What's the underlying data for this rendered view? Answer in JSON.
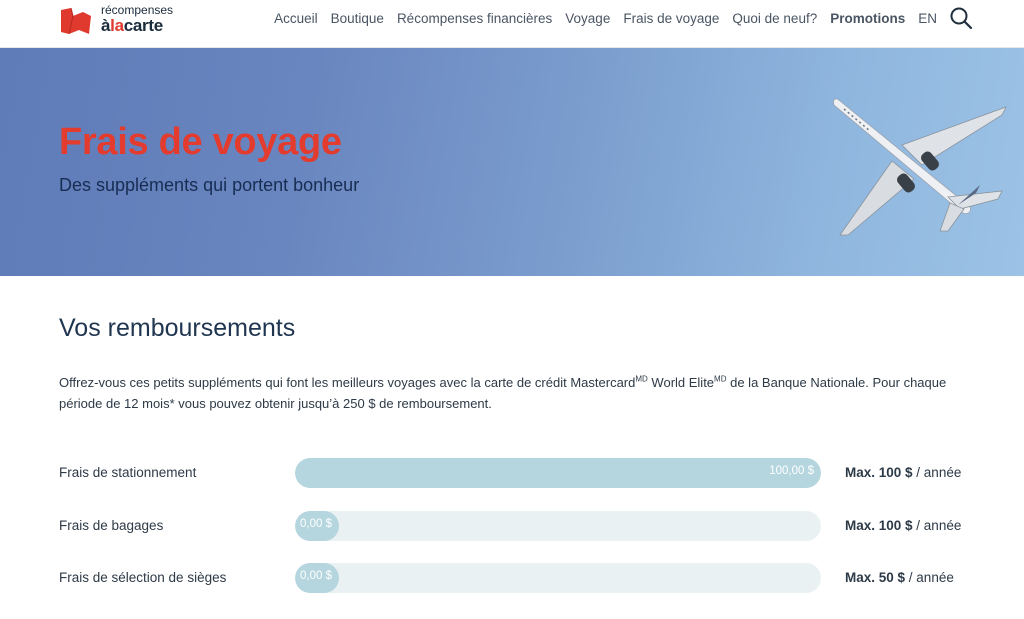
{
  "header": {
    "logo": {
      "line1": "récompenses",
      "line2_prefix": "à",
      "line2_accent": "la",
      "line2_suffix": "carte"
    },
    "nav": [
      "Accueil",
      "Boutique",
      "Récompenses financières",
      "Voyage",
      "Frais de voyage",
      "Quoi de neuf?"
    ],
    "nav_bold": "Promotions",
    "lang": "EN",
    "search_icon": "search-icon"
  },
  "hero": {
    "title": "Frais de voyage",
    "subtitle": "Des suppléments qui portent bonheur"
  },
  "main": {
    "section_title": "Vos remboursements",
    "intro_part1": "Offrez-vous ces petits suppléments qui font les meilleurs voyages avec la carte de crédit Mastercard",
    "intro_sup1": "MD",
    "intro_part2": " World Elite",
    "intro_sup2": "MD",
    "intro_part3": " de la Banque Nationale. Pour chaque période de 12 mois* vous pouvez obtenir jusqu’à 250 $ de remboursement.",
    "rows": [
      {
        "label": "Frais de stationnement",
        "value": "100,00 $",
        "fill_fraction": 1.0,
        "max_bold": "Max. 100 $",
        "max_suffix": " / année"
      },
      {
        "label": "Frais de bagages",
        "value": "0,00 $",
        "fill_fraction": 0.0,
        "max_bold": "Max. 100 $",
        "max_suffix": " / année"
      },
      {
        "label": "Frais de sélection de sièges",
        "value": "0,00 $",
        "fill_fraction": 0.0,
        "max_bold": "Max. 50 $",
        "max_suffix": " / année"
      }
    ]
  },
  "colors": {
    "accent_red": "#e33b2e",
    "navy": "#172d52",
    "bar_fill": "#b5d6de",
    "bar_track": "#e9f1f3"
  }
}
